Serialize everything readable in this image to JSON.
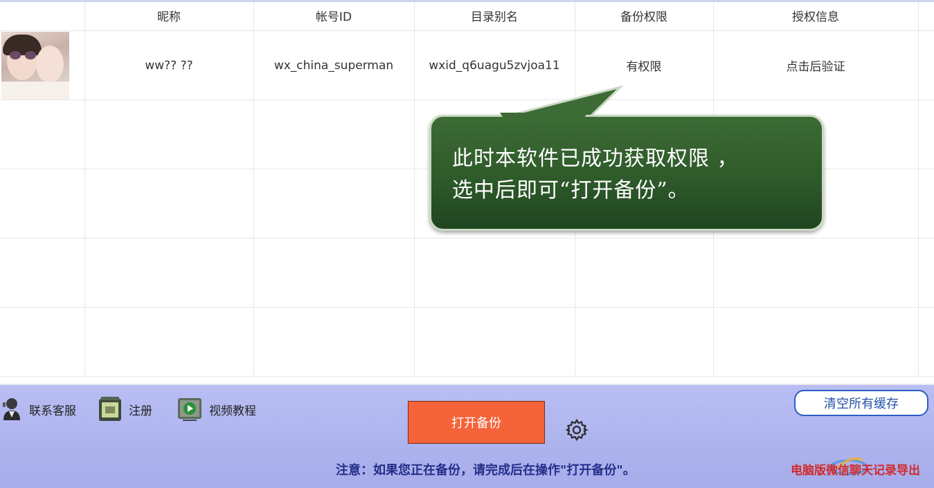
{
  "table": {
    "columns": [
      "",
      "昵称",
      "帐号ID",
      "目录别名",
      "备份权限",
      "授权信息",
      ""
    ],
    "rows": [
      {
        "nickname": "ww?? ??",
        "account_id": "wx_china_superman",
        "alias": "wxid_q6uagu5zvjoa11",
        "permission": "有权限",
        "auth": "点击后验证"
      }
    ]
  },
  "callout": {
    "line1": "此时本软件已成功获取权限 ，",
    "line2": "选中后即可“打开备份”。"
  },
  "toolbar": {
    "contact_label": "联系客服",
    "register_label": "注册",
    "video_label": "视频教程",
    "open_backup_label": "打开备份",
    "clear_cache_label": "清空所有缓存"
  },
  "notice_text": "注意：如果您正在备份，请完成后在操作\"打开备份\"。",
  "watermark_text": "电脑版微信聊天记录导出",
  "colors": {
    "accent": "#f4633a",
    "bottom_bar": "#b0b6ef",
    "callout": "#2f5a2a",
    "notice": "#242f8a"
  }
}
